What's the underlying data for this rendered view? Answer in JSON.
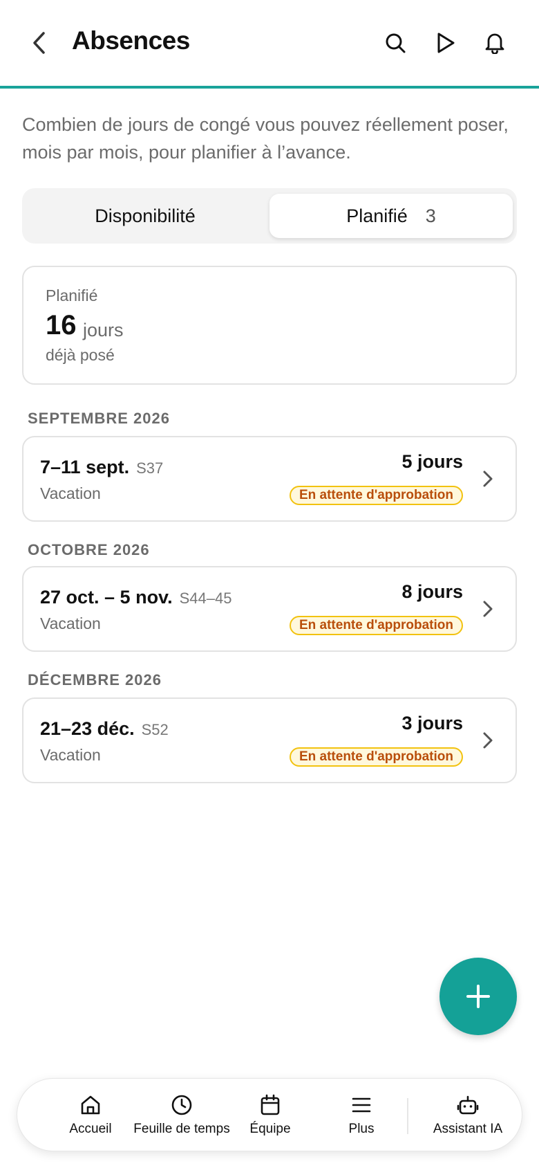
{
  "header": {
    "title": "Absences",
    "icons": [
      "chevron-left-icon",
      "search-icon",
      "play-icon",
      "bell-icon"
    ]
  },
  "description": "Combien de jours de congé vous pouvez réellement poser, mois par mois, pour planifier à l’avance.",
  "segment": {
    "options": [
      {
        "label": "Disponibilité",
        "count": ""
      },
      {
        "label": "Planifié",
        "count": "3"
      }
    ],
    "selected": "Planifié"
  },
  "summary": {
    "label": "Planifié",
    "value": "16",
    "unit": "jours",
    "sub": "déjà posé"
  },
  "sections": [
    {
      "month": "SEPTEMBRE 2026",
      "item": {
        "dates": "7–11 sept.",
        "week": "S37",
        "type": "Vacation",
        "days": "5 jours",
        "status": "En attente d'approbation"
      }
    },
    {
      "month": "OCTOBRE 2026",
      "item": {
        "dates": "27 oct. – 5 nov.",
        "week": "S44–45",
        "type": "Vacation",
        "days": "8 jours",
        "status": "En attente d'approbation"
      }
    },
    {
      "month": "DÉCEMBRE 2026",
      "item": {
        "dates": "21–23 déc.",
        "week": "S52",
        "type": "Vacation",
        "days": "3 jours",
        "status": "En attente d'approbation"
      }
    }
  ],
  "fab": {
    "icon": "plus-icon"
  },
  "nav": {
    "items": [
      {
        "label": "Accueil",
        "icon": "home-icon"
      },
      {
        "label": "Feuille de temps",
        "icon": "clock-icon"
      },
      {
        "label": "Équipe",
        "icon": "calendar-icon"
      },
      {
        "label": "Plus",
        "icon": "menu-icon"
      },
      {
        "label": "Assistant IA",
        "icon": "robot-icon"
      }
    ]
  },
  "colors": {
    "accent": "#19a39a",
    "fab": "#14a197",
    "badge_bg": "#fff8dc",
    "badge_border": "#f2c20f",
    "badge_text": "#b94e0b"
  }
}
